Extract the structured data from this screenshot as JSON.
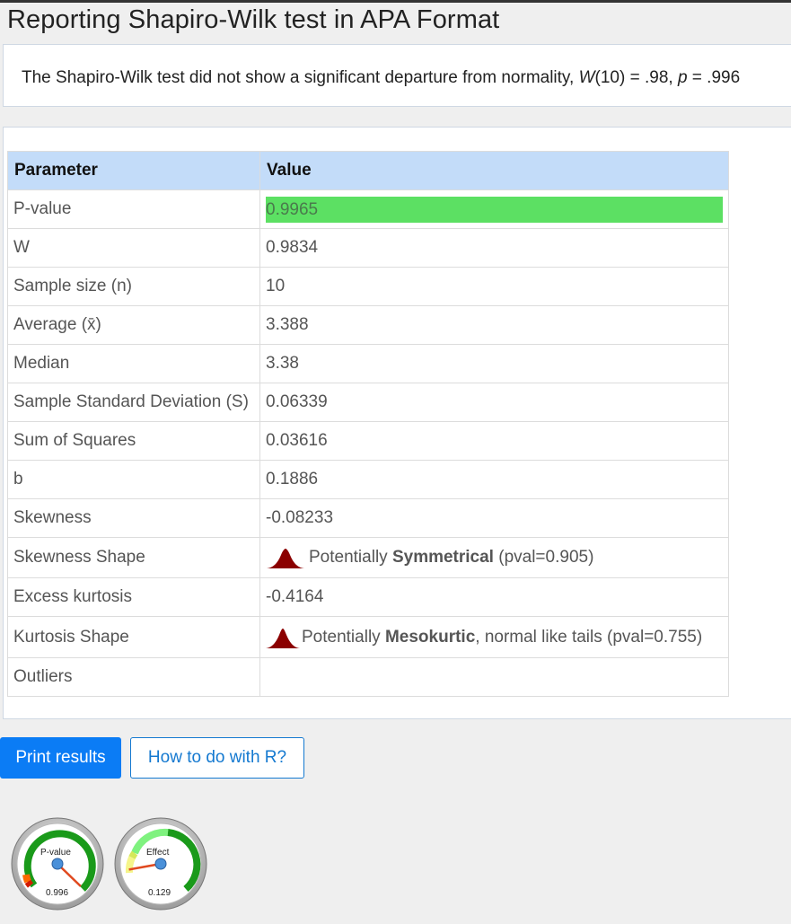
{
  "title": "Reporting Shapiro-Wilk test in APA Format",
  "apa": {
    "prefix": "The Shapiro-Wilk test did not show a significant departure from normality, ",
    "w_symbol": "W",
    "w_args": "(10) = .98, ",
    "p_symbol": "p",
    "p_value": " = .996"
  },
  "table": {
    "headers": [
      "Parameter",
      "Value"
    ],
    "rows": {
      "pvalue": {
        "label": "P-value",
        "value": "0.9965"
      },
      "w": {
        "label": "W",
        "value": "0.9834"
      },
      "n": {
        "label": "Sample size (n)",
        "value": "10"
      },
      "avg": {
        "label": "Average (x̄)",
        "value": "3.388"
      },
      "median": {
        "label": "Median",
        "value": "3.38"
      },
      "sd": {
        "label": "Sample Standard Deviation (S)",
        "value": "0.06339"
      },
      "ss": {
        "label": "Sum of Squares",
        "value": "0.03616"
      },
      "b": {
        "label": "b",
        "value": "0.1886"
      },
      "skew": {
        "label": "Skewness",
        "value": "-0.08233"
      },
      "skewshape": {
        "label": "Skewness Shape",
        "pre": "Potentially ",
        "bold": "Symmetrical",
        "post": " (pval=0.905)"
      },
      "kurt": {
        "label": "Excess kurtosis",
        "value": "-0.4164"
      },
      "kurtshape": {
        "label": "Kurtosis Shape",
        "pre": "Potentially ",
        "bold": "Mesokurtic",
        "post": ", normal like tails (pval=0.755)"
      },
      "outliers": {
        "label": "Outliers",
        "value": ""
      }
    }
  },
  "buttons": {
    "print": "Print results",
    "r": "How to do with R?"
  },
  "gauges": {
    "pvalue": {
      "title": "P-value",
      "readout": "0.996",
      "level": 0.9965
    },
    "effect": {
      "title": "Effect",
      "readout": "0.129",
      "level": 0.129
    }
  },
  "colors": {
    "header_bg": "#c3dcf9",
    "pvalue_bar": "#5ce063",
    "primary": "#0b7cf5",
    "link": "#1a7fd4",
    "teal_link": "#1b9aaa"
  }
}
